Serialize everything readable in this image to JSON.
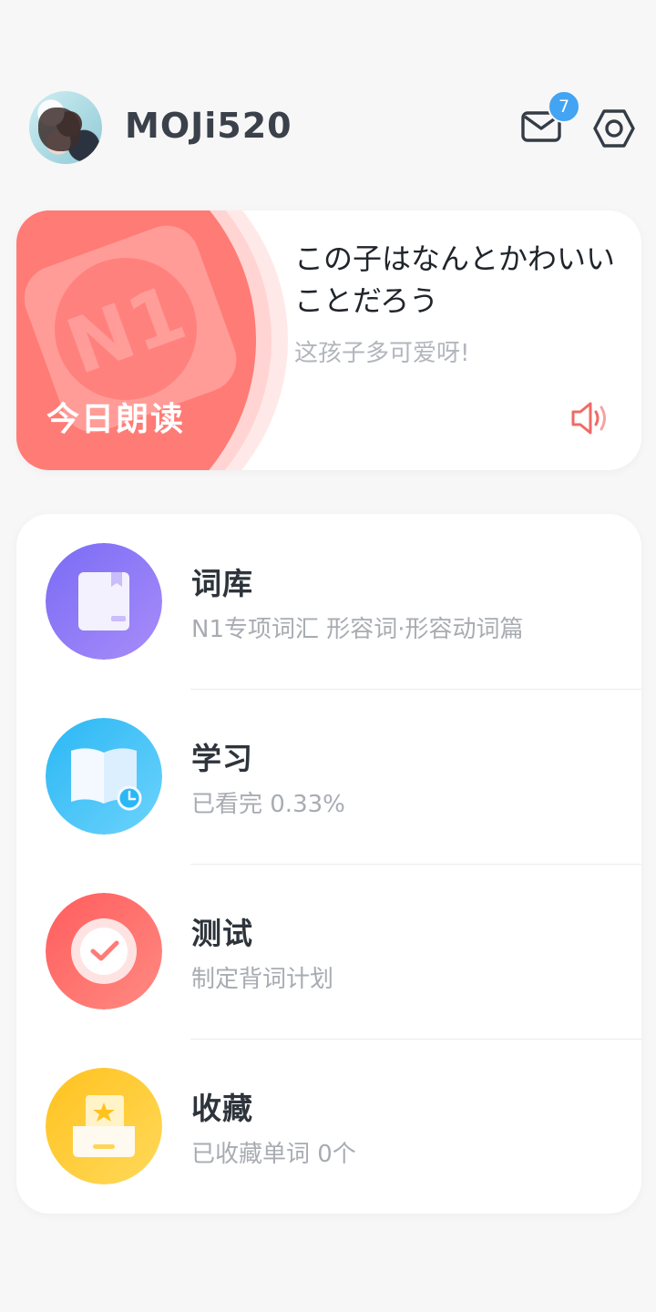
{
  "header": {
    "username": "MOJi520",
    "mail_badge": "7",
    "icons": [
      "mail-icon",
      "settings-icon"
    ]
  },
  "daily_reading": {
    "label": "今日朗读",
    "badge_text": "N1",
    "japanese": "この子はなんとかわいいことだろう",
    "chinese": "这孩子多可爱呀!",
    "accent_color": "#ff7b76"
  },
  "menu": {
    "items": [
      {
        "title": "词库",
        "subtitle": "N1专项词汇 形容词·形容动词篇",
        "icon": "book-icon",
        "color": "#8b6ff7"
      },
      {
        "title": "学习",
        "subtitle": "已看完 0.33%",
        "icon": "open-book-clock-icon",
        "color": "#35bdf5"
      },
      {
        "title": "测试",
        "subtitle": "制定背词计划",
        "icon": "check-target-icon",
        "color": "#ff6b6b"
      },
      {
        "title": "收藏",
        "subtitle": "已收藏单词 0个",
        "icon": "star-box-icon",
        "color": "#ffcb2f"
      }
    ]
  }
}
